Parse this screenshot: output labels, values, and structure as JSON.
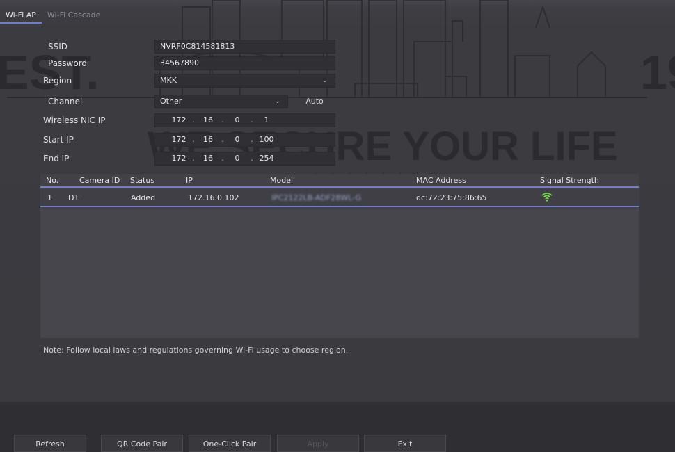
{
  "tabs": [
    "Wi-Fi AP",
    "Wi-Fi Cascade"
  ],
  "form": {
    "ssid_label": "SSID",
    "ssid_value": "NVRF0C814581813",
    "password_label": "Password",
    "password_value": "34567890",
    "region_label": "Region",
    "region_value": "MKK",
    "channel_label": "Channel",
    "channel_value": "Other",
    "auto_label": "Auto",
    "wireless_nic_ip_label": "Wireless NIC IP",
    "wireless_nic_ip": [
      "172",
      "16",
      "0",
      "1"
    ],
    "start_ip_label": "Start IP",
    "start_ip": [
      "172",
      "16",
      "0",
      "100"
    ],
    "end_ip_label": "End IP",
    "end_ip": [
      "172",
      "16",
      "0",
      "254"
    ]
  },
  "table": {
    "columns": [
      "No.",
      "Camera ID",
      "Status",
      "IP",
      "Model",
      "MAC Address",
      "Signal Strength"
    ],
    "rows": [
      {
        "no": "1",
        "camera_id": "D1",
        "status": "Added",
        "ip": "172.16.0.102",
        "model": "IPC2122LB-ADF28WL-G",
        "mac": "dc:72:23:75:86:65",
        "signal": "wifi-signal-icon"
      }
    ]
  },
  "note": "Note: Follow local laws and regulations governing Wi-Fi usage to choose region.",
  "buttons": {
    "refresh": "Refresh",
    "qr_pair": "QR Code Pair",
    "one_click": "One-Click Pair",
    "disabled": "Apply",
    "exit": "Exit"
  },
  "watermark": {
    "left_text": "EST.",
    "right_text": "19",
    "slogan": "WE SECURE YOUR LIFE"
  },
  "colors": {
    "accent": "#7280c8",
    "signal": "#6bdc3c"
  }
}
